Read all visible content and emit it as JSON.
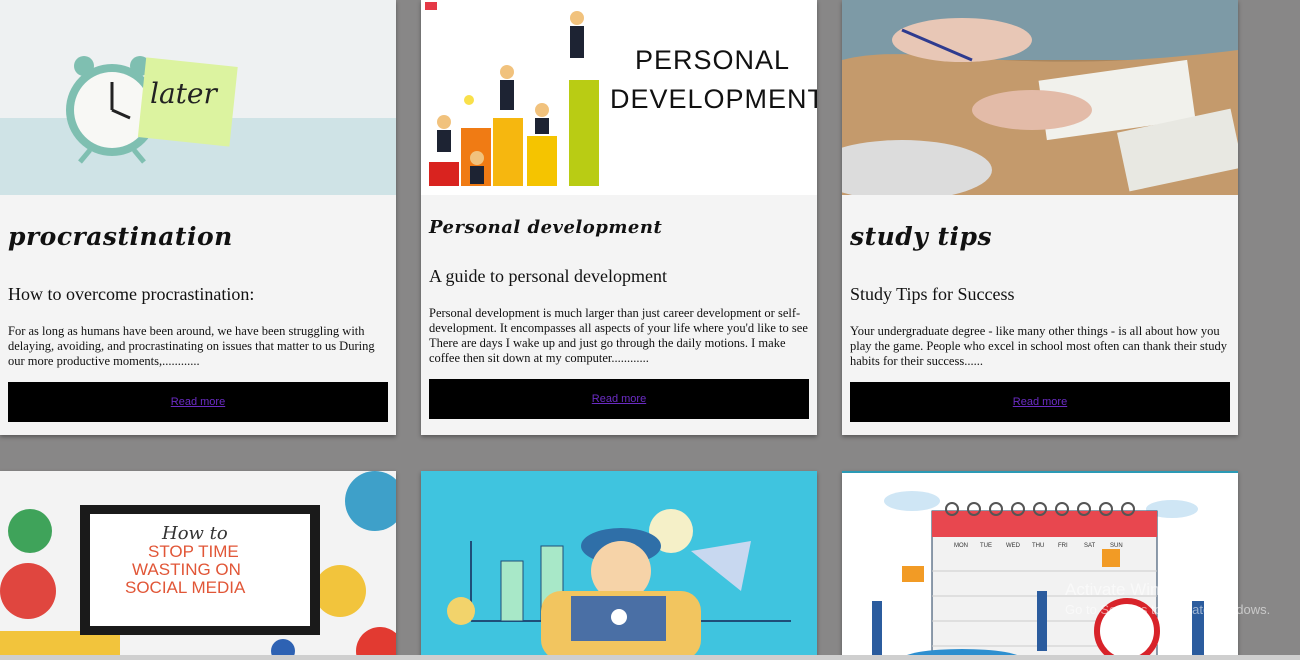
{
  "cards": [
    {
      "image_alt": "alarm clock with later sticky note",
      "image_note": "later",
      "heading": "procrastination",
      "subheading": "How to overcome procrastination:",
      "description": "For as long as humans have been around, we have been struggling with delaying, avoiding, and procrastinating on issues that matter to us During our more productive moments,............",
      "link": "Read more"
    },
    {
      "image_alt": "personal development stair graphic",
      "image_title_line1": "PERSONAL",
      "image_title_line2": "DEVELOPMENT",
      "heading": "Personal development",
      "subheading": "A guide to personal development",
      "description": "Personal development is much larger than just career development or self-development. It encompasses all aspects of your life where you'd like to see There are days I wake up and just go through the daily motions. I make coffee then sit down at my computer............",
      "link": "Read more"
    },
    {
      "image_alt": "students studying with books",
      "heading": "study tips",
      "subheading": "Study Tips for Success",
      "description": "Your undergraduate degree - like many other things - is all about how you play the game. People who excel in school most often can thank their study habits for their success......",
      "link": "Read more"
    },
    {
      "image_alt": "stop time wasting on social media",
      "image_line1": "How to",
      "image_line2": "STOP TIME",
      "image_line3": "WASTING ON",
      "image_line4": "SOCIAL MEDIA"
    },
    {
      "image_alt": "stressed man at laptop illustration"
    },
    {
      "image_alt": "calendar planning illustration",
      "calendar_days": [
        "MON",
        "TUE",
        "WED",
        "THU",
        "FRI",
        "SAT",
        "SUN"
      ]
    }
  ],
  "watermark": {
    "line1": "Activate Windows",
    "line2": "Go to Settings to activate Windows."
  }
}
